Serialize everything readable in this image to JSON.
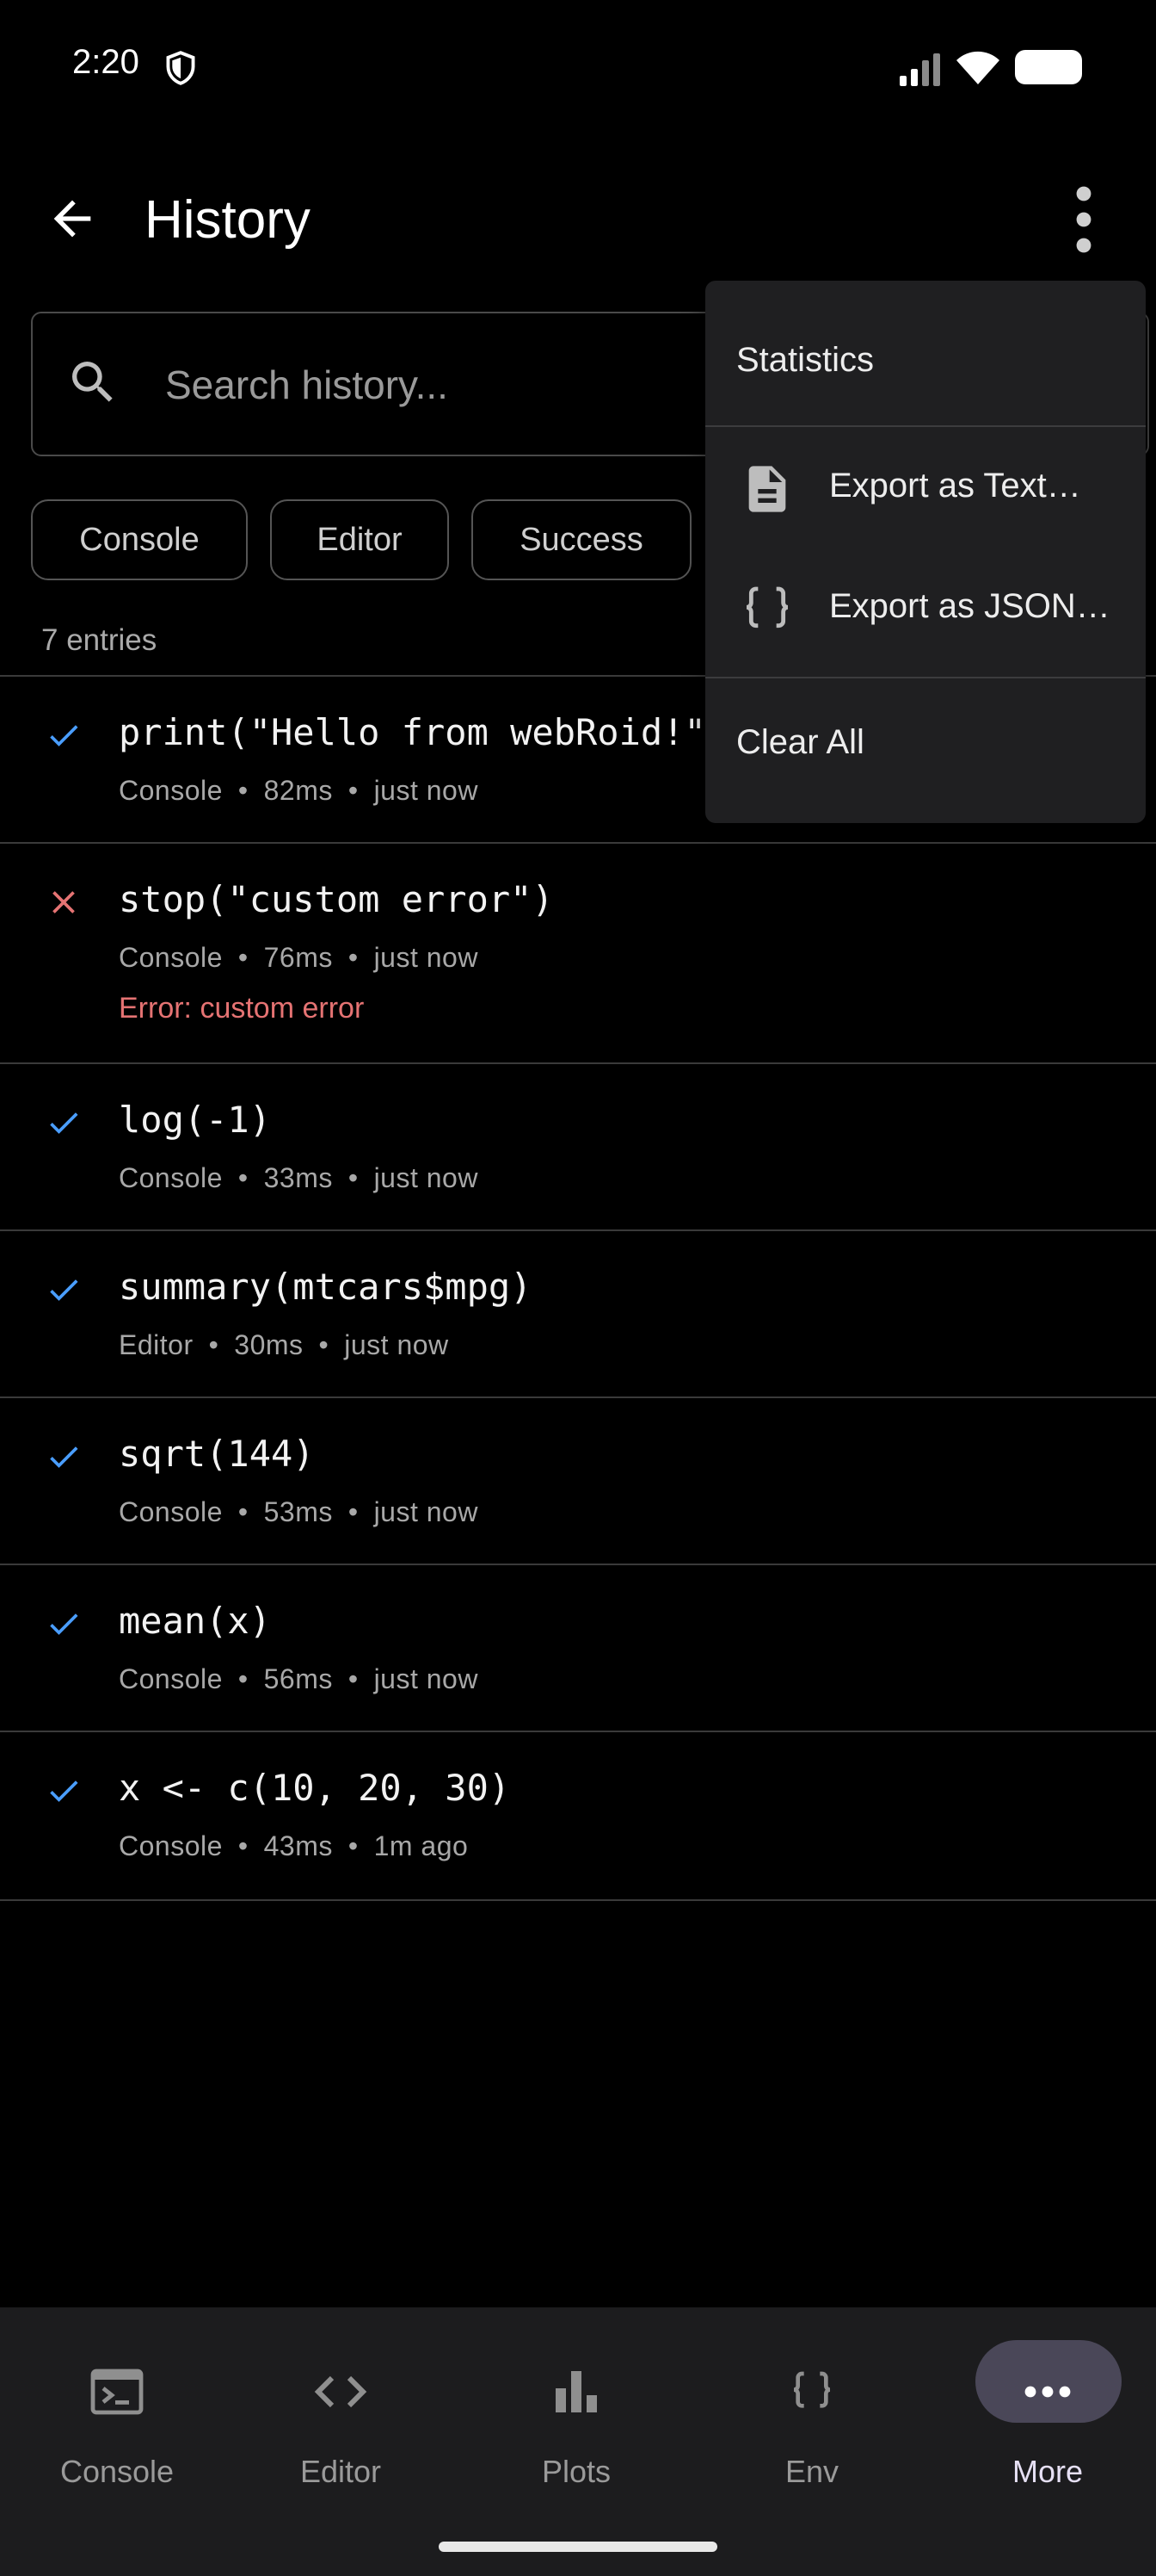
{
  "status_bar": {
    "time": "2:20"
  },
  "app_bar": {
    "title": "History"
  },
  "search": {
    "placeholder": "Search history..."
  },
  "filters": [
    "Console",
    "Editor",
    "Success"
  ],
  "entry_count": "7 entries",
  "entries": [
    {
      "code": "print(\"Hello from webRoid!\")",
      "source": "Console",
      "duration": "82ms",
      "time": "just now",
      "status": "success"
    },
    {
      "code": "stop(\"custom error\")",
      "source": "Console",
      "duration": "76ms",
      "time": "just now",
      "status": "error",
      "error": "Error: custom error"
    },
    {
      "code": "log(-1)",
      "source": "Console",
      "duration": "33ms",
      "time": "just now",
      "status": "success"
    },
    {
      "code": "summary(mtcars$mpg)",
      "source": "Editor",
      "duration": "30ms",
      "time": "just now",
      "status": "success"
    },
    {
      "code": "sqrt(144)",
      "source": "Console",
      "duration": "53ms",
      "time": "just now",
      "status": "success"
    },
    {
      "code": "mean(x)",
      "source": "Console",
      "duration": "56ms",
      "time": "just now",
      "status": "success"
    },
    {
      "code": "x <- c(10, 20, 30)",
      "source": "Console",
      "duration": "43ms",
      "time": "1m ago",
      "status": "success"
    }
  ],
  "menu": {
    "statistics": "Statistics",
    "export_text": "Export as Text…",
    "export_json": "Export as JSON…",
    "clear_all": "Clear All"
  },
  "bottom_nav": {
    "items": [
      {
        "label": "Console",
        "icon": "terminal-icon"
      },
      {
        "label": "Editor",
        "icon": "code-icon"
      },
      {
        "label": "Plots",
        "icon": "bar-chart-icon"
      },
      {
        "label": "Env",
        "icon": "braces-icon"
      },
      {
        "label": "More",
        "icon": "more-horiz-icon",
        "selected": true
      }
    ]
  },
  "colors": {
    "success": "#4a9eff",
    "error": "#e57373",
    "selected_pill": "#4a4758"
  },
  "separator": "•"
}
